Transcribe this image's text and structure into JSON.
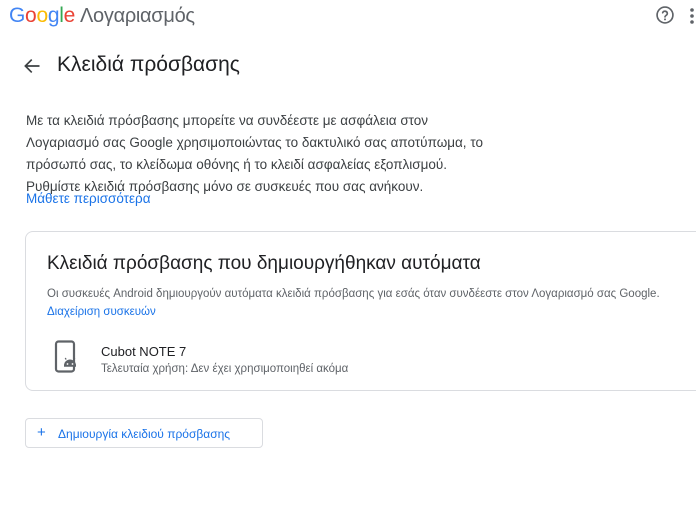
{
  "header": {
    "logo_letters": [
      "G",
      "o",
      "o",
      "g",
      "l",
      "e"
    ],
    "product": "Λογαριασμός",
    "help_icon": "help-circle-icon",
    "more_icon": "more-vert-icon"
  },
  "page": {
    "title": "Κλειδιά πρόσβασης",
    "back_icon": "arrow-back-icon",
    "description": "Με τα κλειδιά πρόσβασης μπορείτε να συνδέεστε με ασφάλεια στον Λογαριασμό σας Google χρησιμοποιώντας το δακτυλικό σας αποτύπωμα, το πρόσωπό σας, το κλείδωμα οθόνης ή το κλειδί ασφαλείας εξοπλισμού. Ρυθμίστε κλειδιά πρόσβασης μόνο σε συσκευές που σας ανήκουν.",
    "learn_more": "Μάθετε περισσότερα"
  },
  "auto_card": {
    "title": "Κλειδιά πρόσβασης που δημιουργήθηκαν αυτόματα",
    "description": "Οι συσκευές Android δημιουργούν αυτόματα κλειδιά πρόσβασης για εσάς όταν συνδέεστε στον Λογαριασμό σας Google.",
    "manage_link": "Διαχείριση συσκευών",
    "device": {
      "icon": "android-phone-icon",
      "name": "Cubot NOTE 7",
      "last_used": "Τελευταία χρήση: Δεν έχει χρησιμοποιηθεί ακόμα"
    }
  },
  "create_button": {
    "icon": "plus-icon",
    "label": "Δημιουργία κλειδιού πρόσβασης"
  },
  "colors": {
    "accent": "#1a73e8",
    "border": "#dadce0",
    "text_secondary": "#5f6368"
  }
}
